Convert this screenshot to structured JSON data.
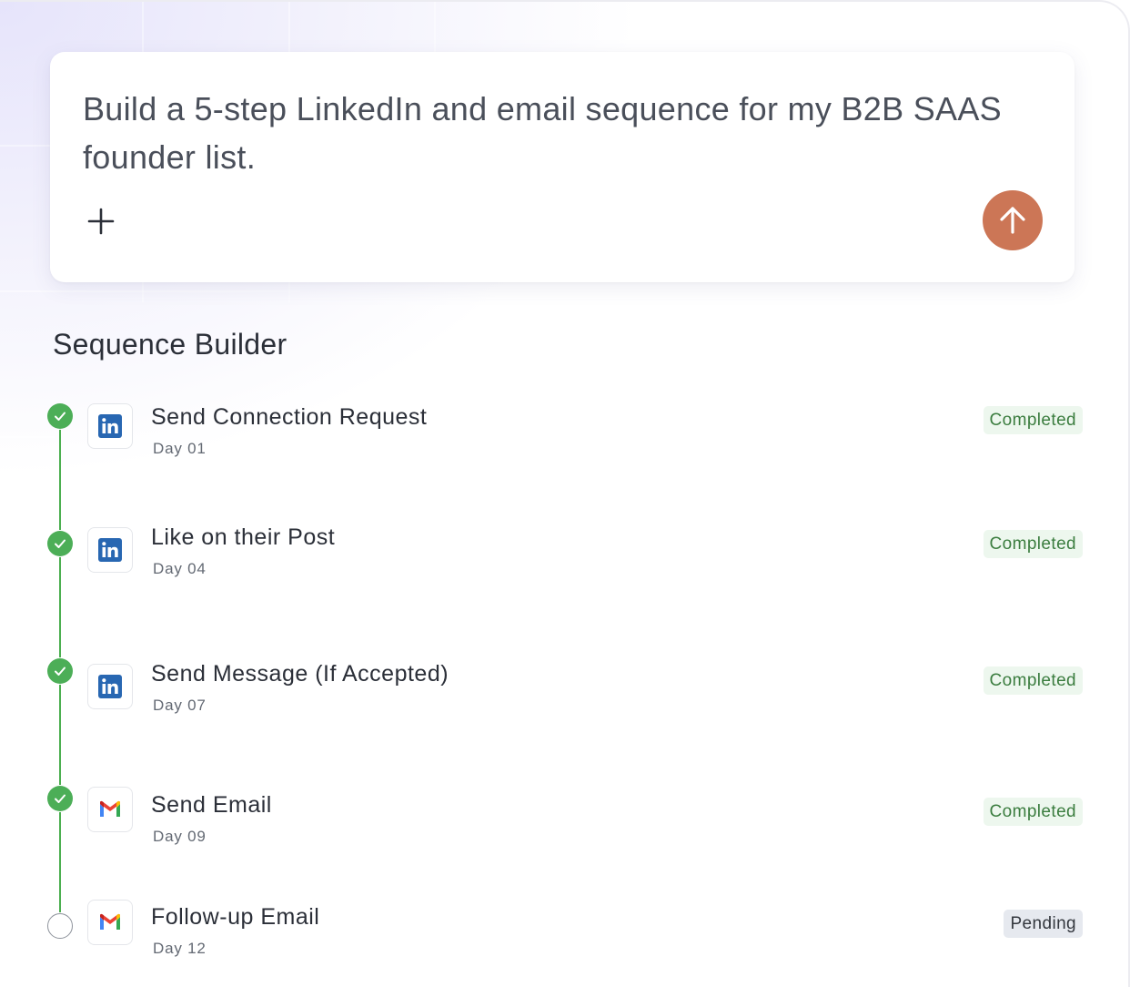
{
  "prompt": {
    "text": "Build a 5-step LinkedIn and email sequence for my B2B SAAS founder list.",
    "add_icon": "plus-icon",
    "send_icon": "arrow-up-icon",
    "send_color": "#cc7656"
  },
  "sequence": {
    "title": "Sequence Builder",
    "steps": [
      {
        "title": "Send Connection Request",
        "day": "Day 01",
        "status": "Completed",
        "channel": "linkedin-icon"
      },
      {
        "title": "Like on their Post",
        "day": "Day 04",
        "status": "Completed",
        "channel": "linkedin-icon"
      },
      {
        "title": "Send Message (If Accepted)",
        "day": "Day 07",
        "status": "Completed",
        "channel": "linkedin-icon"
      },
      {
        "title": "Send Email",
        "day": "Day 09",
        "status": "Completed",
        "channel": "gmail-icon"
      },
      {
        "title": "Follow-up Email",
        "day": "Day 12",
        "status": "Pending",
        "channel": "gmail-icon"
      }
    ]
  },
  "colors": {
    "completed": "#4cae57",
    "linkedin": "#2867b2",
    "accent": "#cc7656"
  }
}
